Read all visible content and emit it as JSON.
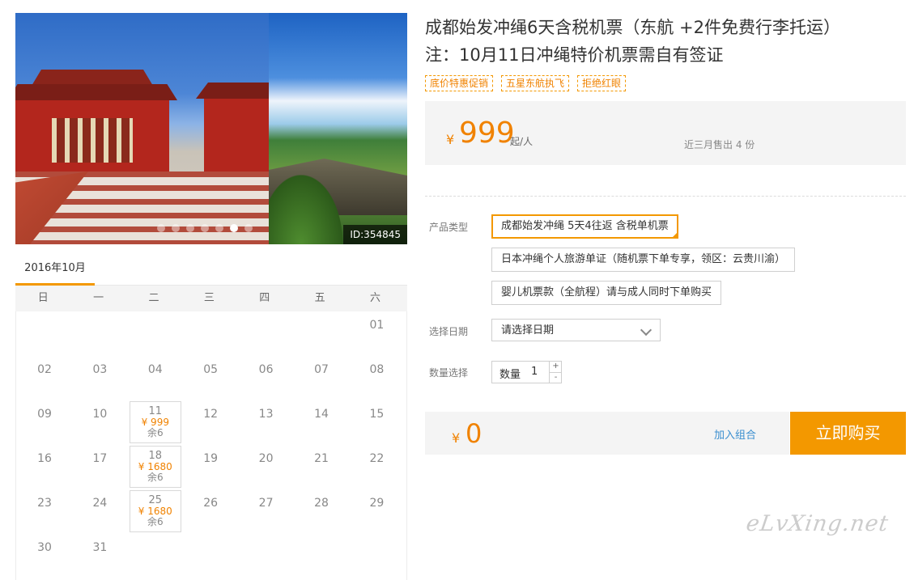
{
  "gallery": {
    "id_tag": "ID:354845",
    "slide_count": 7,
    "active_slide": 6
  },
  "calendar": {
    "month": "2016年10月",
    "weekdays": [
      "日",
      "一",
      "二",
      "三",
      "四",
      "五",
      "六"
    ],
    "days": [
      {
        "d": "01"
      },
      {
        "d": "02"
      },
      {
        "d": "03"
      },
      {
        "d": "04"
      },
      {
        "d": "05"
      },
      {
        "d": "06"
      },
      {
        "d": "07"
      },
      {
        "d": "08"
      },
      {
        "d": "09"
      },
      {
        "d": "10"
      },
      {
        "d": "11",
        "price": "¥ 999",
        "left": "余6"
      },
      {
        "d": "12"
      },
      {
        "d": "13"
      },
      {
        "d": "14"
      },
      {
        "d": "15"
      },
      {
        "d": "16"
      },
      {
        "d": "17"
      },
      {
        "d": "18",
        "price": "¥ 1680",
        "left": "余6"
      },
      {
        "d": "19"
      },
      {
        "d": "20"
      },
      {
        "d": "21"
      },
      {
        "d": "22"
      },
      {
        "d": "23"
      },
      {
        "d": "24"
      },
      {
        "d": "25",
        "price": "¥ 1680",
        "left": "余6"
      },
      {
        "d": "26"
      },
      {
        "d": "27"
      },
      {
        "d": "28"
      },
      {
        "d": "29"
      },
      {
        "d": "30"
      },
      {
        "d": "31"
      }
    ]
  },
  "product": {
    "title_line1": "成都始发冲绳6天含税机票（东航 +2件免费行李托运）",
    "title_line2": "注：10月11日冲绳特价机票需自有签证",
    "badges": [
      "底价特惠促销",
      "五星东航执飞",
      "拒绝红眼"
    ],
    "price_symbol": "¥",
    "price": "999",
    "price_unit": "起/人",
    "sold": "近三月售出 4 份"
  },
  "form": {
    "type_label": "产品类型",
    "options": [
      "成都始发冲绳 5天4往返 含税单机票",
      "日本冲绳个人旅游单证（随机票下单专享，领区：云贵川渝）",
      "婴儿机票款（全航程）请与成人同时下单购买"
    ],
    "selected_index": 0,
    "date_label": "选择日期",
    "date_placeholder": "请选择日期",
    "qty_label": "数量选择",
    "qty_inner_label": "数量",
    "qty_value": "1",
    "plus": "+",
    "minus": "-"
  },
  "checkout": {
    "symbol": "¥",
    "total": "0",
    "add_combo": "加入组合",
    "buy": "立即购买"
  },
  "watermark": "eLvXing.net",
  "colors": {
    "accent": "#f39800",
    "price": "#f08200",
    "link": "#3a8ecf"
  }
}
